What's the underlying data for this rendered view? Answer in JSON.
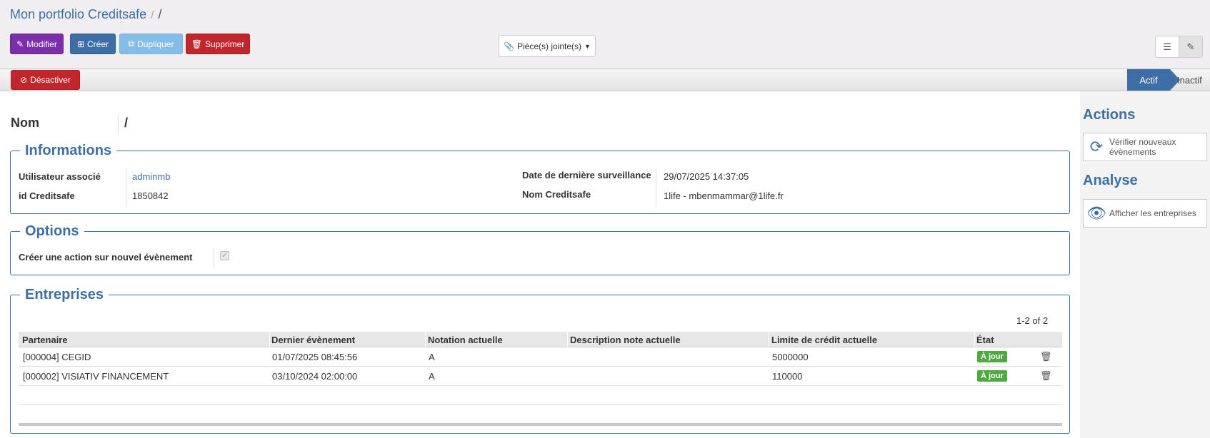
{
  "breadcrumb": {
    "root": "Mon portfolio Creditsafe",
    "separator": "/",
    "current": "/"
  },
  "toolbar": {
    "modifier": "Modifier",
    "creer": "Créer",
    "dupliquer": "Dupliquer",
    "supprimer": "Supprimer",
    "attachments": "Pièce(s) jointe(s)"
  },
  "statusbar": {
    "desactiver": "Désactiver",
    "states": [
      "Actif",
      "Inactif"
    ],
    "current_state": "Actif"
  },
  "record": {
    "nom_label": "Nom",
    "nom_value": "/"
  },
  "informations": {
    "title": "Informations",
    "utilisateur_label": "Utilisateur associé",
    "utilisateur_value": "adminmb",
    "id_label": "id Creditsafe",
    "id_value": "1850842",
    "date_label": "Date de dernière surveillance",
    "date_value": "29/07/2025 14:37:05",
    "nom_cs_label": "Nom Creditsafe",
    "nom_cs_value": "1life - mbenmammar@1life.fr"
  },
  "options": {
    "title": "Options",
    "creer_action_label": "Créer une action sur nouvel évènement",
    "creer_action_checked": true
  },
  "entreprises": {
    "title": "Entreprises",
    "pager": "1-2 of 2",
    "columns": [
      "Partenaire",
      "Dernier évènement",
      "Notation actuelle",
      "Description note actuelle",
      "Limite de crédit actuelle",
      "État"
    ],
    "rows": [
      {
        "partenaire": "[000004] CEGID",
        "dernier": "01/07/2025 08:45:56",
        "notation": "A",
        "description": "",
        "limite": "5000000",
        "etat": "À jour"
      },
      {
        "partenaire": "[000002] VISIATIV FINANCEMENT",
        "dernier": "03/10/2024 02:00:00",
        "notation": "A",
        "description": "",
        "limite": "110000",
        "etat": "À jour"
      }
    ]
  },
  "sidebar": {
    "actions_title": "Actions",
    "verifier": "Vérifier nouveaux évènements",
    "analyse_title": "Analyse",
    "afficher": "Afficher les entreprises"
  },
  "colors": {
    "accent": "#3d6fa6",
    "purple": "#7b2fa8",
    "danger": "#c0262b",
    "success": "#4caa3e",
    "light_blue": "#85bde9"
  }
}
